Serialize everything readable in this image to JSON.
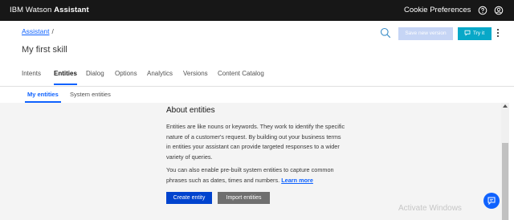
{
  "topbar": {
    "brand_prefix": "IBM Watson ",
    "brand_name": "Assistant",
    "cookie_label": "Cookie Preferences",
    "help_icon": "help-icon",
    "user_icon": "user-icon"
  },
  "header": {
    "breadcrumb_link": "Assistant",
    "breadcrumb_sep": "/",
    "save_label": "Save new version",
    "try_label": "Try it",
    "skill_title": "My first skill"
  },
  "tabs": [
    "Intents",
    "Entities",
    "Dialog",
    "Options",
    "Analytics",
    "Versions",
    "Content Catalog"
  ],
  "active_tab": "Entities",
  "subtabs": [
    "My entities",
    "System entities"
  ],
  "active_subtab": "My entities",
  "about": {
    "title": "About entities",
    "para1": "Entities are like nouns or keywords. They work to identify the specific nature of a customer's request. By building out your business terms in entities your assistant can provide targeted responses to a wider variety of queries.",
    "para2_text": "You can also enable pre-built system entities to capture common phrases such as dates, times and numbers. ",
    "learn_more": "Learn more",
    "create_label": "Create entity",
    "import_label": "Import entities"
  },
  "watermark": "Activate Windows",
  "colors": {
    "topbar": "#171717",
    "accent_blue": "#0f62fe",
    "primary_button": "#0043ce",
    "try_button": "#08a8c8",
    "content_bg": "#f4f4f4"
  }
}
